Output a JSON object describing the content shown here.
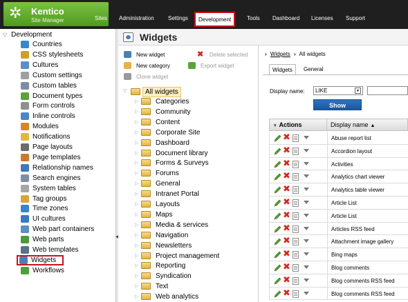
{
  "header": {
    "logo_brand": "Kentico",
    "logo_sub": "Site Manager",
    "menu": [
      {
        "label": "Sites"
      },
      {
        "label": "Administration"
      },
      {
        "label": "Settings"
      },
      {
        "label": "Development"
      },
      {
        "label": "Tools"
      },
      {
        "label": "Dashboard"
      },
      {
        "label": "Licenses"
      },
      {
        "label": "Support"
      }
    ],
    "active_menu": "Development"
  },
  "left_tree": {
    "root_label": "Development",
    "items": [
      {
        "label": "Countries",
        "icon": "globe-icon",
        "color": "#3a86c8"
      },
      {
        "label": "CSS stylesheets",
        "icon": "brush-icon",
        "color": "#c9a227"
      },
      {
        "label": "Cultures",
        "icon": "globe-icon",
        "color": "#5a8fc9"
      },
      {
        "label": "Custom settings",
        "icon": "wrench-icon",
        "color": "#a0a0a0"
      },
      {
        "label": "Custom tables",
        "icon": "table-icon",
        "color": "#7b8ea6"
      },
      {
        "label": "Document types",
        "icon": "document-icon",
        "color": "#5aa33a"
      },
      {
        "label": "Form controls",
        "icon": "pen-icon",
        "color": "#8f8f8f"
      },
      {
        "label": "Inline controls",
        "icon": "control-icon",
        "color": "#4b87c5"
      },
      {
        "label": "Modules",
        "icon": "modules-icon",
        "color": "#d9862a"
      },
      {
        "label": "Notifications",
        "icon": "notification-icon",
        "color": "#e0b93b"
      },
      {
        "label": "Page layouts",
        "icon": "layout-icon",
        "color": "#6b6b6b"
      },
      {
        "label": "Page templates",
        "icon": "template-icon",
        "color": "#c97a2a"
      },
      {
        "label": "Relationship names",
        "icon": "relationship-icon",
        "color": "#3f78bd"
      },
      {
        "label": "Search engines",
        "icon": "search-icon",
        "color": "#7c8fa5"
      },
      {
        "label": "System tables",
        "icon": "table-icon",
        "color": "#a7a7a7"
      },
      {
        "label": "Tag groups",
        "icon": "tag-icon",
        "color": "#d6a63a"
      },
      {
        "label": "Time zones",
        "icon": "clock-icon",
        "color": "#3a86c8"
      },
      {
        "label": "UI cultures",
        "icon": "globe-icon",
        "color": "#3a7ac0"
      },
      {
        "label": "Web part containers",
        "icon": "container-icon",
        "color": "#5d8ec4"
      },
      {
        "label": "Web parts",
        "icon": "webpart-icon",
        "color": "#4c9a3a"
      },
      {
        "label": "Web templates",
        "icon": "web-template-icon",
        "color": "#5c6f8c"
      },
      {
        "label": "Widgets",
        "icon": "widget-icon",
        "color": "#4d7fb0"
      },
      {
        "label": "Workflows",
        "icon": "workflow-icon",
        "color": "#4ea03b"
      }
    ],
    "selected": "Widgets"
  },
  "page_title": "Widgets",
  "middle": {
    "actions": [
      {
        "label": "New widget",
        "icon": "new-widget-icon",
        "enabled": true,
        "color": "#4d7fb0"
      },
      {
        "label": "Delete selected",
        "icon": "delete-icon",
        "enabled": false,
        "color": "#d12b1f"
      },
      {
        "label": "New category",
        "icon": "new-category-icon",
        "enabled": true,
        "color": "#e3b445"
      },
      {
        "label": "Export widget",
        "icon": "export-icon",
        "enabled": false,
        "color": "#5aa33a"
      },
      {
        "label": "Clone widget",
        "icon": "clone-icon",
        "enabled": false,
        "color": "#9a9a9a"
      }
    ],
    "tree_root": "All widgets",
    "categories": [
      "Categories",
      "Community",
      "Content",
      "Corporate Site",
      "Dashboard",
      "Document library",
      "Forms & Surveys",
      "Forums",
      "General",
      "Intranet Portal",
      "Layouts",
      "Maps",
      "Media & services",
      "Navigation",
      "Newsletters",
      "Project management",
      "Reporting",
      "Syndication",
      "Text",
      "Web analytics"
    ]
  },
  "right": {
    "breadcrumb": {
      "link": "Widgets",
      "current": "All widgets"
    },
    "tabs": [
      {
        "label": "Widgets",
        "active": true
      },
      {
        "label": "General",
        "active": false
      }
    ],
    "filter": {
      "label": "Display name:",
      "operator": "LIKE",
      "value": "",
      "button": "Show"
    },
    "grid": {
      "col_actions": "Actions",
      "col_name": "Display name",
      "rows": [
        "Abuse report list",
        "Accordion layout",
        "Activities",
        "Analytics chart viewer",
        "Analytics table viewer",
        "Article List",
        "Article List",
        "Articles RSS feed",
        "Attachment image gallery",
        "Bing maps",
        "Blog comments",
        "Blog comments RSS feed",
        "Blog comments RSS feed"
      ]
    }
  },
  "colors": {
    "header_bg": "#1f1f1f",
    "logo_green": "#6db23a",
    "highlight_red": "#c8101e",
    "show_button": "#2566ae",
    "selected_node_bg": "#fdeec0"
  }
}
